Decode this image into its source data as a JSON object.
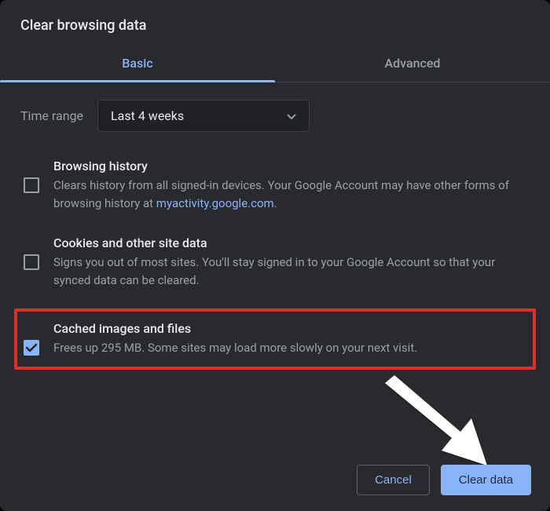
{
  "title": "Clear browsing data",
  "tabs": {
    "basic": "Basic",
    "advanced": "Advanced"
  },
  "time_range": {
    "label": "Time range",
    "selected": "Last 4 weeks"
  },
  "options": {
    "browsing_history": {
      "title": "Browsing history",
      "desc_pre": "Clears history from all signed-in devices. Your Google Account may have other forms of browsing history at ",
      "link_text": "myactivity.google.com",
      "desc_post": "."
    },
    "cookies": {
      "title": "Cookies and other site data",
      "desc": "Signs you out of most sites. You'll stay signed in to your Google Account so that your synced data can be cleared."
    },
    "cache": {
      "title": "Cached images and files",
      "desc": "Frees up 295 MB. Some sites may load more slowly on your next visit."
    }
  },
  "buttons": {
    "cancel": "Cancel",
    "clear": "Clear data"
  }
}
